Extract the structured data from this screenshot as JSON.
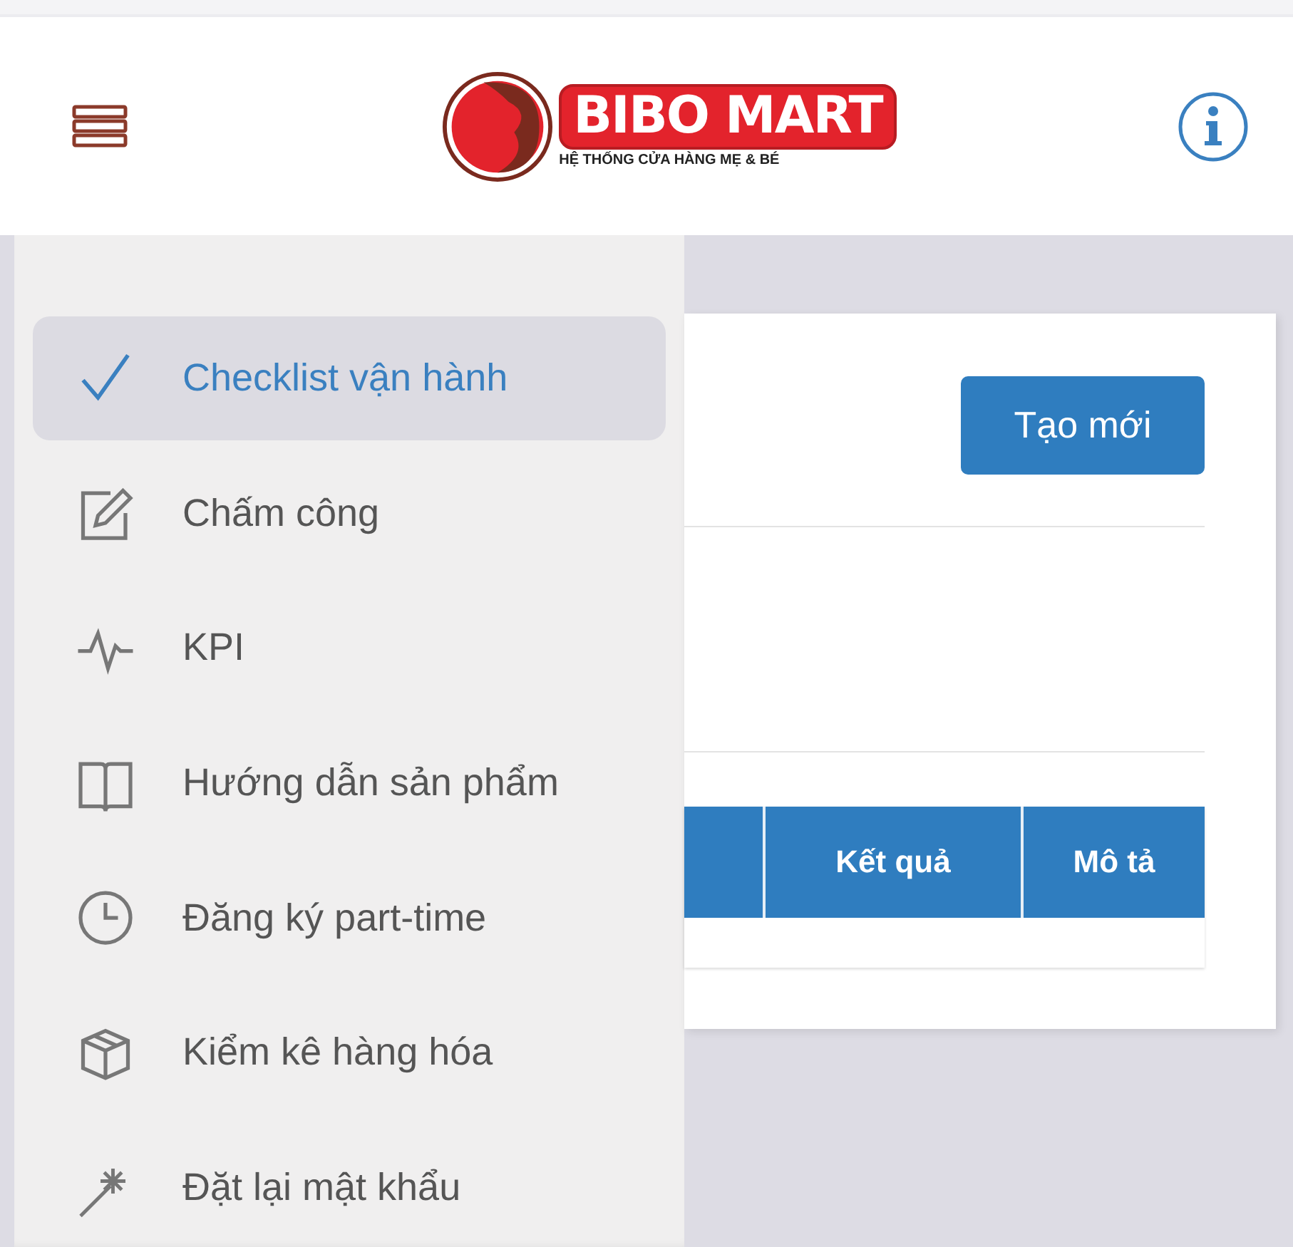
{
  "header": {
    "brand": "BIBO MART",
    "tagline": "HỆ THỐNG CỬA HÀNG MẸ & BÉ"
  },
  "drawer": {
    "items": [
      {
        "label": "Checklist vận hành",
        "selected": true
      },
      {
        "label": "Chấm công",
        "selected": false
      },
      {
        "label": "KPI",
        "selected": false
      },
      {
        "label": "Hướng dẫn sản phẩm",
        "selected": false
      },
      {
        "label": "Đăng ký part-time",
        "selected": false
      },
      {
        "label": "Kiểm kê hàng hóa",
        "selected": false
      },
      {
        "label": "Đặt lại mật khẩu",
        "selected": false
      }
    ]
  },
  "content": {
    "create_button": "Tạo mới",
    "table": {
      "columns": [
        "Kết quả",
        "Mô tả"
      ]
    }
  }
}
